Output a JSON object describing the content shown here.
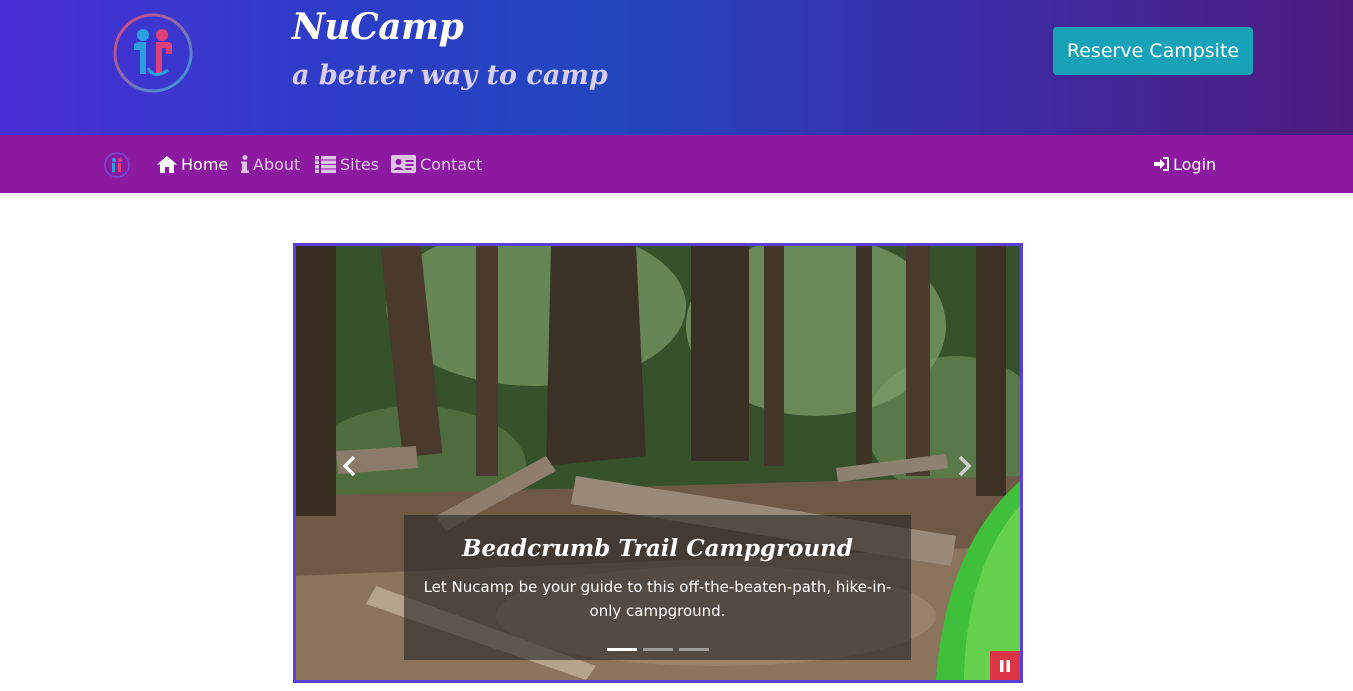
{
  "header": {
    "brand_title": "NuCamp",
    "tagline": "a better way to camp",
    "reserve_label": "Reserve Campsite",
    "accent_color": "#17a2b8"
  },
  "navbar": {
    "background": "#8c1aa0",
    "items": [
      {
        "label": "Home",
        "icon": "home-icon",
        "active": true
      },
      {
        "label": "About",
        "icon": "info-icon",
        "active": false
      },
      {
        "label": "Sites",
        "icon": "list-icon",
        "active": false
      },
      {
        "label": "Contact",
        "icon": "address-card-icon",
        "active": false
      }
    ],
    "login_label": "Login",
    "login_icon": "sign-in-icon"
  },
  "carousel": {
    "caption_title": "Beadcrumb Trail Campground",
    "caption_text": "Let Nucamp be your guide to this off-the-beaten-path, hike-in-only campground.",
    "slide_count": 3,
    "active_index": 0,
    "prev_icon": "chevron-left-icon",
    "next_icon": "chevron-right-icon",
    "pause_icon": "pause-icon",
    "pause_color": "#dc3545"
  }
}
